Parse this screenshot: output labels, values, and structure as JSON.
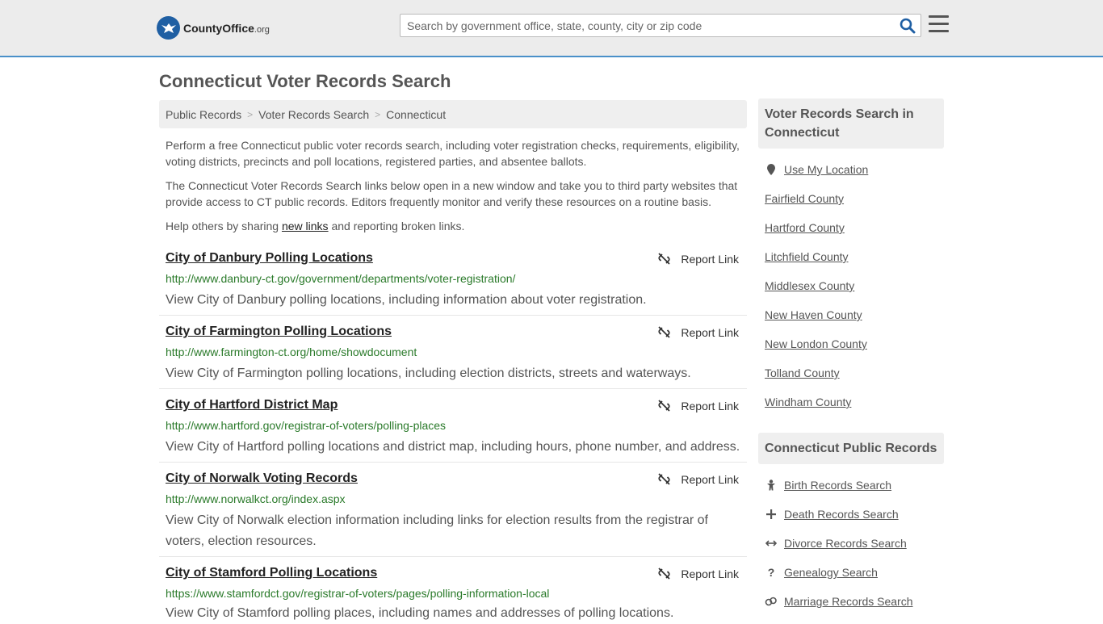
{
  "header": {
    "logo_brand": "CountyOffice",
    "logo_tld": ".org",
    "search_placeholder": "Search by government office, state, county, city or zip code"
  },
  "page": {
    "title": "Connecticut Voter Records Search"
  },
  "breadcrumb": [
    "Public Records",
    "Voter Records Search",
    "Connecticut"
  ],
  "intro": {
    "p1": "Perform a free Connecticut public voter records search, including voter registration checks, requirements, eligibility, voting districts, precincts and poll locations, registered parties, and absentee ballots.",
    "p2": "The Connecticut Voter Records Search links below open in a new window and take you to third party websites that provide access to CT public records. Editors frequently monitor and verify these resources on a routine basis.",
    "p3_before": "Help others by sharing ",
    "p3_link": "new links",
    "p3_after": " and reporting broken links."
  },
  "listings": [
    {
      "title": "City of Danbury Polling Locations",
      "url": "http://www.danbury-ct.gov/government/departments/voter-registration/",
      "desc": "View City of Danbury polling locations, including information about voter registration.",
      "report": "Report Link"
    },
    {
      "title": "City of Farmington Polling Locations",
      "url": "http://www.farmington-ct.org/home/showdocument",
      "desc": "View City of Farmington polling locations, including election districts, streets and waterways.",
      "report": "Report Link"
    },
    {
      "title": "City of Hartford District Map",
      "url": "http://www.hartford.gov/registrar-of-voters/polling-places",
      "desc": "View City of Hartford polling locations and district map, including hours, phone number, and address.",
      "report": "Report Link"
    },
    {
      "title": "City of Norwalk Voting Records",
      "url": "http://www.norwalkct.org/index.aspx",
      "desc": "View City of Norwalk election information including links for election results from the registrar of voters, election resources.",
      "report": "Report Link"
    },
    {
      "title": "City of Stamford Polling Locations",
      "url": "https://www.stamfordct.gov/registrar-of-voters/pages/polling-information-local",
      "desc": "View City of Stamford polling places, including names and addresses of polling locations.",
      "report": "Report Link"
    }
  ],
  "sidebar": {
    "section1_title": "Voter Records Search in Connecticut",
    "use_location": "Use My Location",
    "counties": [
      "Fairfield County",
      "Hartford County",
      "Litchfield County",
      "Middlesex County",
      "New Haven County",
      "New London County",
      "Tolland County",
      "Windham County"
    ],
    "section2_title": "Connecticut Public Records",
    "records": [
      {
        "label": "Birth Records Search",
        "icon": "baby-icon"
      },
      {
        "label": "Death Records Search",
        "icon": "cross-icon"
      },
      {
        "label": "Divorce Records Search",
        "icon": "split-arrows-icon"
      },
      {
        "label": "Genealogy Search",
        "icon": "question-icon"
      },
      {
        "label": "Marriage Records Search",
        "icon": "marriage-icon"
      }
    ]
  }
}
